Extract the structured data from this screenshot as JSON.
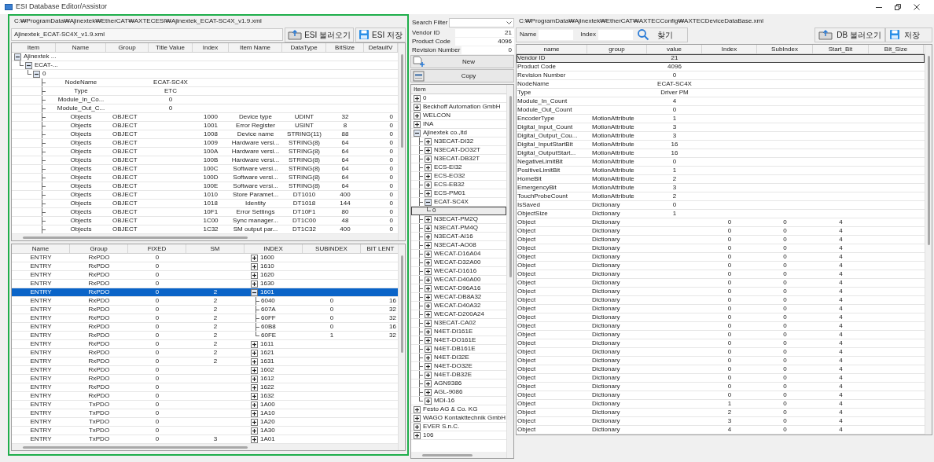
{
  "window": {
    "title": "ESI Database Editor/Assistor"
  },
  "esi_panel": {
    "path": "C:₩ProgramData₩Ajinextek₩EtherCAT₩AXTECESI₩Ajinextek_ECAT-SC4X_v1.9.xml",
    "file_name": "Ajinextek_ECAT-SC4X_v1.9.xml",
    "buttons": [
      {
        "label": "ESI 불러오기",
        "kind": "open"
      },
      {
        "label": "ESI 저장",
        "kind": "save"
      }
    ],
    "object_table": {
      "columns": [
        "Item",
        "Name",
        "Group",
        "Title Value",
        "Index",
        "Item Name",
        "DataType",
        "BitSize",
        "DefaultV"
      ],
      "rows": [
        {
          "item": "Ajinextek ...",
          "expanded": true,
          "children": [
            {
              "item": "ECAT-...",
              "expanded": true,
              "children": [
                {
                  "item": "0",
                  "expanded": true,
                  "children": [
                    {
                      "name": "NodeName",
                      "title_value": "ECAT-SC4X"
                    },
                    {
                      "name": "Type",
                      "title_value": "ETC"
                    },
                    {
                      "name": "Module_In_Co...",
                      "title_value": "0"
                    },
                    {
                      "name": "Module_Out_C...",
                      "title_value": "0"
                    },
                    {
                      "name": "Objects",
                      "group": "OBJECT",
                      "index": "1000",
                      "item_name": "Device type",
                      "data_type": "UDINT",
                      "bit_size": "32",
                      "default_value": "0"
                    },
                    {
                      "name": "Objects",
                      "group": "OBJECT",
                      "index": "1001",
                      "item_name": "Error Register",
                      "data_type": "USINT",
                      "bit_size": "8",
                      "default_value": "0"
                    },
                    {
                      "name": "Objects",
                      "group": "OBJECT",
                      "index": "1008",
                      "item_name": "Device name",
                      "data_type": "STRING(11)",
                      "bit_size": "88",
                      "default_value": "0"
                    },
                    {
                      "name": "Objects",
                      "group": "OBJECT",
                      "index": "1009",
                      "item_name": "Hardware versi...",
                      "data_type": "STRING(8)",
                      "bit_size": "64",
                      "default_value": "0"
                    },
                    {
                      "name": "Objects",
                      "group": "OBJECT",
                      "index": "100A",
                      "item_name": "Hardware versi...",
                      "data_type": "STRING(8)",
                      "bit_size": "64",
                      "default_value": "0"
                    },
                    {
                      "name": "Objects",
                      "group": "OBJECT",
                      "index": "100B",
                      "item_name": "Hardware versi...",
                      "data_type": "STRING(8)",
                      "bit_size": "64",
                      "default_value": "0"
                    },
                    {
                      "name": "Objects",
                      "group": "OBJECT",
                      "index": "100C",
                      "item_name": "Software versi...",
                      "data_type": "STRING(8)",
                      "bit_size": "64",
                      "default_value": "0"
                    },
                    {
                      "name": "Objects",
                      "group": "OBJECT",
                      "index": "100D",
                      "item_name": "Software versi...",
                      "data_type": "STRING(8)",
                      "bit_size": "64",
                      "default_value": "0"
                    },
                    {
                      "name": "Objects",
                      "group": "OBJECT",
                      "index": "100E",
                      "item_name": "Software versi...",
                      "data_type": "STRING(8)",
                      "bit_size": "64",
                      "default_value": "0"
                    },
                    {
                      "name": "Objects",
                      "group": "OBJECT",
                      "index": "1010",
                      "item_name": "Store Paramet...",
                      "data_type": "DT1010",
                      "bit_size": "400",
                      "default_value": "0"
                    },
                    {
                      "name": "Objects",
                      "group": "OBJECT",
                      "index": "1018",
                      "item_name": "Identity",
                      "data_type": "DT1018",
                      "bit_size": "144",
                      "default_value": "0"
                    },
                    {
                      "name": "Objects",
                      "group": "OBJECT",
                      "index": "10F1",
                      "item_name": "Error Settings",
                      "data_type": "DT10F1",
                      "bit_size": "80",
                      "default_value": "0"
                    },
                    {
                      "name": "Objects",
                      "group": "OBJECT",
                      "index": "1C00",
                      "item_name": "Sync manager...",
                      "data_type": "DT1C00",
                      "bit_size": "48",
                      "default_value": "0"
                    },
                    {
                      "name": "Objects",
                      "group": "OBJECT",
                      "index": "1C32",
                      "item_name": "SM output par...",
                      "data_type": "DT1C32",
                      "bit_size": "400",
                      "default_value": "0"
                    }
                  ]
                }
              ]
            }
          ]
        }
      ]
    },
    "pdo_table": {
      "columns": [
        "Name",
        "Group",
        "FIXED",
        "SM",
        "INDEX",
        "SUBINDEX",
        "BIT LENT"
      ],
      "rows": [
        {
          "name": "ENTRY",
          "group": "RxPDO",
          "fixed": "0",
          "index": "1600",
          "expanded": false,
          "selected": false
        },
        {
          "name": "ENTRY",
          "group": "RxPDO",
          "fixed": "0",
          "index": "1610",
          "expanded": false,
          "selected": false
        },
        {
          "name": "ENTRY",
          "group": "RxPDO",
          "fixed": "0",
          "index": "1620",
          "expanded": false,
          "selected": false
        },
        {
          "name": "ENTRY",
          "group": "RxPDO",
          "fixed": "0",
          "index": "1630",
          "expanded": false,
          "selected": false
        },
        {
          "name": "ENTRY",
          "group": "RxPDO",
          "fixed": "0",
          "sm": "2",
          "index": "1601",
          "expanded": true,
          "selected": true,
          "children": [
            {
              "name": "ENTRY",
              "group": "RxPDO",
              "fixed": "0",
              "sm": "2",
              "index": "6040",
              "subindex": "0",
              "bit_length": "16",
              "selected": false
            },
            {
              "name": "ENTRY",
              "group": "RxPDO",
              "fixed": "0",
              "sm": "2",
              "index": "607A",
              "subindex": "0",
              "bit_length": "32",
              "selected": false
            },
            {
              "name": "ENTRY",
              "group": "RxPDO",
              "fixed": "0",
              "sm": "2",
              "index": "60FF",
              "subindex": "0",
              "bit_length": "32",
              "selected": false
            },
            {
              "name": "ENTRY",
              "group": "RxPDO",
              "fixed": "0",
              "sm": "2",
              "index": "60B8",
              "subindex": "0",
              "bit_length": "16",
              "selected": false
            },
            {
              "name": "ENTRY",
              "group": "RxPDO",
              "fixed": "0",
              "sm": "2",
              "index": "60FE",
              "subindex": "1",
              "bit_length": "32",
              "selected": false
            }
          ]
        },
        {
          "name": "ENTRY",
          "group": "RxPDO",
          "fixed": "0",
          "sm": "2",
          "index": "1611",
          "expanded": false,
          "selected": false
        },
        {
          "name": "ENTRY",
          "group": "RxPDO",
          "fixed": "0",
          "sm": "2",
          "index": "1621",
          "expanded": false,
          "selected": false
        },
        {
          "name": "ENTRY",
          "group": "RxPDO",
          "fixed": "0",
          "sm": "2",
          "index": "1631",
          "expanded": false,
          "selected": false
        },
        {
          "name": "ENTRY",
          "group": "RxPDO",
          "fixed": "0",
          "index": "1602",
          "expanded": false,
          "selected": false
        },
        {
          "name": "ENTRY",
          "group": "RxPDO",
          "fixed": "0",
          "index": "1612",
          "expanded": false,
          "selected": false
        },
        {
          "name": "ENTRY",
          "group": "RxPDO",
          "fixed": "0",
          "index": "1622",
          "expanded": false,
          "selected": false
        },
        {
          "name": "ENTRY",
          "group": "RxPDO",
          "fixed": "0",
          "index": "1632",
          "expanded": false,
          "selected": false
        },
        {
          "name": "ENTRY",
          "group": "TxPDO",
          "fixed": "0",
          "index": "1A00",
          "expanded": false,
          "selected": false
        },
        {
          "name": "ENTRY",
          "group": "TxPDO",
          "fixed": "0",
          "index": "1A10",
          "expanded": false,
          "selected": false
        },
        {
          "name": "ENTRY",
          "group": "TxPDO",
          "fixed": "0",
          "index": "1A20",
          "expanded": false,
          "selected": false
        },
        {
          "name": "ENTRY",
          "group": "TxPDO",
          "fixed": "0",
          "index": "1A30",
          "expanded": false,
          "selected": false
        },
        {
          "name": "ENTRY",
          "group": "TxPDO",
          "fixed": "0",
          "sm": "3",
          "index": "1A01",
          "expanded": false,
          "selected": false
        }
      ]
    }
  },
  "device_panel": {
    "search_filter": {
      "label": "Search Filter"
    },
    "fields": [
      {
        "label": "Vendor ID",
        "value": "21"
      },
      {
        "label": "Product Code",
        "value": "4096"
      },
      {
        "label": "Revision Number",
        "value": "0"
      }
    ],
    "buttons": [
      {
        "label": "New",
        "kind": "new"
      },
      {
        "label": "Copy",
        "kind": "copy"
      }
    ],
    "tree": {
      "header": "Item",
      "items": [
        {
          "label": "0",
          "expanded": false,
          "selected": false
        },
        {
          "label": "Beckhoff Automation GmbH",
          "expanded": false,
          "selected": false
        },
        {
          "label": "WELCON",
          "expanded": false,
          "selected": false
        },
        {
          "label": "INA",
          "expanded": false,
          "selected": false
        },
        {
          "label": "Ajinextek co.,ltd",
          "expanded": true,
          "selected": false,
          "children": [
            {
              "label": "N3ECAT-DI32",
              "expanded": false,
              "selected": false
            },
            {
              "label": "N3ECAT-DO32T",
              "expanded": false,
              "selected": false
            },
            {
              "label": "N3ECAT-DB32T",
              "expanded": false,
              "selected": false
            },
            {
              "label": "ECS-EI32",
              "expanded": false,
              "selected": false
            },
            {
              "label": "ECS-EO32",
              "expanded": false,
              "selected": false
            },
            {
              "label": "ECS-EB32",
              "expanded": false,
              "selected": false
            },
            {
              "label": "ECS-PM01",
              "expanded": false,
              "selected": false
            },
            {
              "label": "ECAT-SC4X",
              "expanded": true,
              "selected": false,
              "children": [
                {
                  "label": "0",
                  "selected": true
                }
              ]
            },
            {
              "label": "N3ECAT-PM2Q",
              "expanded": false,
              "selected": false
            },
            {
              "label": "N3ECAT-PM4Q",
              "expanded": false,
              "selected": false
            },
            {
              "label": "N3ECAT-AI16",
              "expanded": false,
              "selected": false
            },
            {
              "label": "N3ECAT-AO08",
              "expanded": false,
              "selected": false
            },
            {
              "label": "WECAT-D16A04",
              "expanded": false,
              "selected": false
            },
            {
              "label": "WECAT-D32A00",
              "expanded": false,
              "selected": false
            },
            {
              "label": "WECAT-D1616",
              "expanded": false,
              "selected": false
            },
            {
              "label": "WECAT-D40A00",
              "expanded": false,
              "selected": false
            },
            {
              "label": "WECAT-D96A16",
              "expanded": false,
              "selected": false
            },
            {
              "label": "WECAT-DB8A32",
              "expanded": false,
              "selected": false
            },
            {
              "label": "WECAT-D40A32",
              "expanded": false,
              "selected": false
            },
            {
              "label": "WECAT-D200A24",
              "expanded": false,
              "selected": false
            },
            {
              "label": "N3ECAT-CA02",
              "expanded": false,
              "selected": false
            },
            {
              "label": "N4ET-DI161E",
              "expanded": false,
              "selected": false
            },
            {
              "label": "N4ET-DO161E",
              "expanded": false,
              "selected": false
            },
            {
              "label": "N4ET-DB161E",
              "expanded": false,
              "selected": false
            },
            {
              "label": "N4ET-DI32E",
              "expanded": false,
              "selected": false
            },
            {
              "label": "N4ET-DO32E",
              "expanded": false,
              "selected": false
            },
            {
              "label": "N4ET-DB32E",
              "expanded": false,
              "selected": false
            },
            {
              "label": "AGN9386",
              "expanded": false,
              "selected": false
            },
            {
              "label": "AGL-9086",
              "expanded": false,
              "selected": false
            },
            {
              "label": "MDI-16",
              "expanded": false,
              "selected": false
            }
          ]
        },
        {
          "label": "Festo AG & Co. KG",
          "expanded": false,
          "selected": false
        },
        {
          "label": "WAGO Kontakttechnik GmbH",
          "expanded": false,
          "selected": false
        },
        {
          "label": "EVER S.n.C.",
          "expanded": false,
          "selected": false
        },
        {
          "label": "106",
          "expanded": false,
          "selected": false
        }
      ]
    }
  },
  "database_panel": {
    "path": "C:₩ProgramData₩Ajinextek₩EtherCAT₩AXTECConfig₩AXTECDeviceDataBase.xml",
    "search": {
      "name_label": "Name",
      "index_label": "Index",
      "button": "찾기"
    },
    "buttons": [
      {
        "label": "DB 불러오기",
        "kind": "open"
      },
      {
        "label": "저장",
        "kind": "save"
      }
    ],
    "table": {
      "columns": [
        "name",
        "group",
        "value",
        "Index",
        "SubIndex",
        "Start_Bit",
        "Bit_Size"
      ],
      "rows": [
        {
          "name": "Vendor ID",
          "value": "21",
          "selected": true
        },
        {
          "name": "Product Code",
          "value": "4096",
          "selected": false
        },
        {
          "name": "Revision Number",
          "value": "0",
          "selected": false
        },
        {
          "name": "NodeName",
          "value": "ECAT-SC4X",
          "selected": false
        },
        {
          "name": "Type",
          "value": "Driver PM",
          "selected": false
        },
        {
          "name": "Module_In_Count",
          "value": "4",
          "selected": false
        },
        {
          "name": "Module_Out_Count",
          "value": "0",
          "selected": false
        },
        {
          "name": "EncoderType",
          "group": "MotionAttribute",
          "value": "1",
          "selected": false
        },
        {
          "name": "Digital_Input_Count",
          "group": "MotionAttribute",
          "value": "3",
          "selected": false
        },
        {
          "name": "Digital_Output_Cou...",
          "group": "MotionAttribute",
          "value": "3",
          "selected": false
        },
        {
          "name": "Digital_InputStartBit",
          "group": "MotionAttribute",
          "value": "16",
          "selected": false
        },
        {
          "name": "Digital_OutputStart...",
          "group": "MotionAttribute",
          "value": "16",
          "selected": false
        },
        {
          "name": "NegativeLimitBit",
          "group": "MotionAttribute",
          "value": "0",
          "selected": false
        },
        {
          "name": "PositiveLimitBit",
          "group": "MotionAttribute",
          "value": "1",
          "selected": false
        },
        {
          "name": "HomeBit",
          "group": "MotionAttribute",
          "value": "2",
          "selected": false
        },
        {
          "name": "EmergencyBit",
          "group": "MotionAttribute",
          "value": "3",
          "selected": false
        },
        {
          "name": "TouchProbeCount",
          "group": "MotionAttribute",
          "value": "2",
          "selected": false
        },
        {
          "name": "IsSaved",
          "group": "Dictionary",
          "value": "0",
          "selected": false
        },
        {
          "name": "ObjectSize",
          "group": "Dictionary",
          "value": "1",
          "selected": false
        },
        {
          "name": "Object",
          "group": "Dictionary",
          "index": "0",
          "subindex": "0",
          "start_bit": "4",
          "selected": false
        },
        {
          "name": "Object",
          "group": "Dictionary",
          "index": "0",
          "subindex": "0",
          "start_bit": "4",
          "selected": false
        },
        {
          "name": "Object",
          "group": "Dictionary",
          "index": "0",
          "subindex": "0",
          "start_bit": "4",
          "selected": false
        },
        {
          "name": "Object",
          "group": "Dictionary",
          "index": "0",
          "subindex": "0",
          "start_bit": "4",
          "selected": false
        },
        {
          "name": "Object",
          "group": "Dictionary",
          "index": "0",
          "subindex": "0",
          "start_bit": "4",
          "selected": false
        },
        {
          "name": "Object",
          "group": "Dictionary",
          "index": "0",
          "subindex": "0",
          "start_bit": "4",
          "selected": false
        },
        {
          "name": "Object",
          "group": "Dictionary",
          "index": "0",
          "subindex": "0",
          "start_bit": "4",
          "selected": false
        },
        {
          "name": "Object",
          "group": "Dictionary",
          "index": "0",
          "subindex": "0",
          "start_bit": "4",
          "selected": false
        },
        {
          "name": "Object",
          "group": "Dictionary",
          "index": "0",
          "subindex": "0",
          "start_bit": "4",
          "selected": false
        },
        {
          "name": "Object",
          "group": "Dictionary",
          "index": "0",
          "subindex": "0",
          "start_bit": "4",
          "selected": false
        },
        {
          "name": "Object",
          "group": "Dictionary",
          "index": "0",
          "subindex": "0",
          "start_bit": "4",
          "selected": false
        },
        {
          "name": "Object",
          "group": "Dictionary",
          "index": "0",
          "subindex": "0",
          "start_bit": "4",
          "selected": false
        },
        {
          "name": "Object",
          "group": "Dictionary",
          "index": "0",
          "subindex": "0",
          "start_bit": "4",
          "selected": false
        },
        {
          "name": "Object",
          "group": "Dictionary",
          "index": "0",
          "subindex": "0",
          "start_bit": "4",
          "selected": false
        },
        {
          "name": "Object",
          "group": "Dictionary",
          "index": "0",
          "subindex": "0",
          "start_bit": "4",
          "selected": false
        },
        {
          "name": "Object",
          "group": "Dictionary",
          "index": "0",
          "subindex": "0",
          "start_bit": "4",
          "selected": false
        },
        {
          "name": "Object",
          "group": "Dictionary",
          "index": "0",
          "subindex": "0",
          "start_bit": "4",
          "selected": false
        },
        {
          "name": "Object",
          "group": "Dictionary",
          "index": "0",
          "subindex": "0",
          "start_bit": "4",
          "selected": false
        },
        {
          "name": "Object",
          "group": "Dictionary",
          "index": "0",
          "subindex": "0",
          "start_bit": "4",
          "selected": false
        },
        {
          "name": "Object",
          "group": "Dictionary",
          "index": "0",
          "subindex": "0",
          "start_bit": "4",
          "selected": false
        },
        {
          "name": "Object",
          "group": "Dictionary",
          "index": "0",
          "subindex": "0",
          "start_bit": "4",
          "selected": false
        },
        {
          "name": "Object",
          "group": "Dictionary",
          "index": "1",
          "subindex": "0",
          "start_bit": "4",
          "selected": false
        },
        {
          "name": "Object",
          "group": "Dictionary",
          "index": "2",
          "subindex": "0",
          "start_bit": "4",
          "selected": false
        },
        {
          "name": "Object",
          "group": "Dictionary",
          "index": "3",
          "subindex": "0",
          "start_bit": "4",
          "selected": false
        },
        {
          "name": "Object",
          "group": "Dictionary",
          "index": "4",
          "subindex": "0",
          "start_bit": "4",
          "selected": false
        }
      ]
    }
  }
}
